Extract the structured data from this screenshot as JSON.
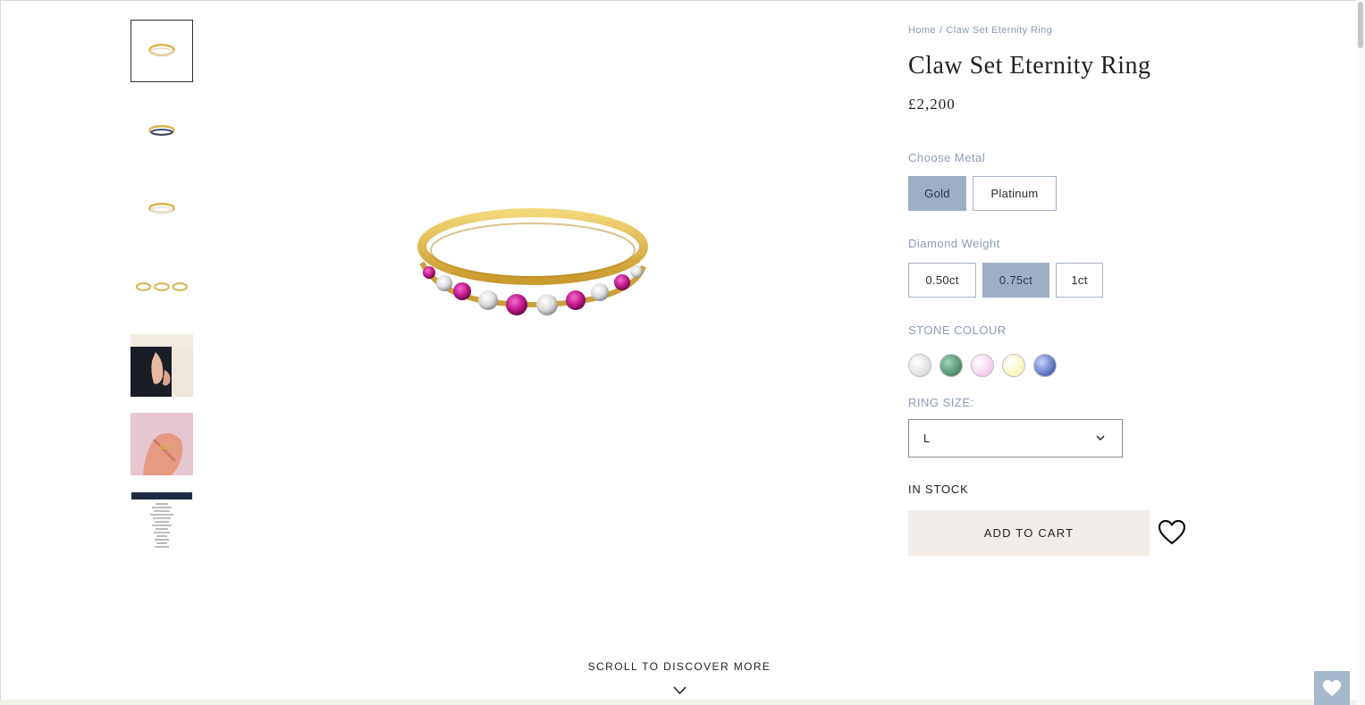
{
  "breadcrumb": {
    "home": "Home",
    "separator": "/",
    "current": "Claw Set Eternity Ring"
  },
  "product": {
    "title": "Claw Set Eternity Ring",
    "price": "£2,200",
    "stock_status": "IN STOCK",
    "add_to_cart_label": "ADD TO CART"
  },
  "metal": {
    "label": "Choose Metal",
    "options": [
      "Gold",
      "Platinum"
    ],
    "selected": "Gold"
  },
  "diamond_weight": {
    "label": "Diamond Weight",
    "options": [
      "0.50ct",
      "0.75ct",
      "1ct"
    ],
    "selected": "0.75ct"
  },
  "stone_colour": {
    "label": "STONE COLOUR",
    "swatches": [
      {
        "name": "white",
        "color": "#e8e8e8"
      },
      {
        "name": "green",
        "color": "#2e6b4f"
      },
      {
        "name": "pink",
        "color": "#f1b4e6"
      },
      {
        "name": "yellow",
        "color": "#f7f0a0"
      },
      {
        "name": "blue",
        "color": "#1f3f9a"
      }
    ]
  },
  "ring_size": {
    "label": "RING SIZE:",
    "selected": "L"
  },
  "gallery": {
    "thumbnails": [
      {
        "name": "thumbnail-ring-pink"
      },
      {
        "name": "thumbnail-ring-blue"
      },
      {
        "name": "thumbnail-ring-white"
      },
      {
        "name": "thumbnail-three-rings"
      },
      {
        "name": "thumbnail-hands-dark"
      },
      {
        "name": "thumbnail-hand-pink"
      },
      {
        "name": "thumbnail-certificate"
      }
    ],
    "active_index": 0
  },
  "footer": {
    "scroll_more": "SCROLL TO DISCOVER MORE"
  },
  "colors": {
    "accent_blue": "#9dafc5",
    "cart_bg": "#f1ece8",
    "label_grey_blue": "#8a9bb3",
    "gold": "#d9b24a",
    "ruby": "#c21a8a"
  },
  "icons": {
    "wishlist": "heart-outline-icon",
    "select_chevron": "chevron-down-icon",
    "scroll_chevron": "chevron-down-icon",
    "fav_widget": "heart-filled-icon"
  }
}
